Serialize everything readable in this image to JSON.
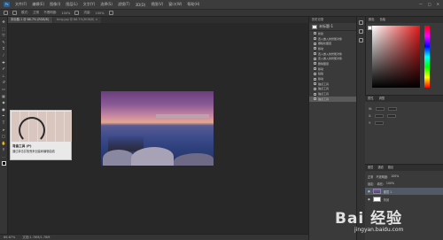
{
  "menubar": {
    "app_logo": "Ps",
    "items": [
      "文件(F)",
      "编辑(E)",
      "图像(I)",
      "图层(L)",
      "文字(Y)",
      "选择(S)",
      "滤镜(T)",
      "3D(D)",
      "视图(V)",
      "窗口(W)",
      "帮助(H)"
    ],
    "window_controls": [
      "—",
      "□",
      "✕"
    ]
  },
  "optionsbar": {
    "mode_label": "模式:",
    "mode_value": "正常",
    "opacity_label": "不透明度:",
    "opacity_value": "100%",
    "flow_label": "流量:",
    "flow_value": "100%"
  },
  "tabs": [
    {
      "label": "未标题-1 @ 66.7% (RGB/8)",
      "active": true
    },
    {
      "label": "timg.jpg @ 66.7%(RGB/8) ×",
      "active": false
    }
  ],
  "tooltip": {
    "title": "弯曲工具 (P)",
    "description": "通过单击并拖曳来创建和编辑曲线"
  },
  "statusbar": {
    "zoom": "66.67%",
    "doc_info": "文档:1.76M/1.76M"
  },
  "history": {
    "header": "历史记录",
    "snapshot": "未标题-1",
    "items": [
      {
        "label": "新建",
        "selected": false
      },
      {
        "label": "置入嵌入的智能对象",
        "selected": false
      },
      {
        "label": "栅格化图层",
        "selected": false
      },
      {
        "label": "移动",
        "selected": false
      },
      {
        "label": "置入嵌入的智能对象",
        "selected": false
      },
      {
        "label": "置入嵌入的智能对象",
        "selected": false
      },
      {
        "label": "删除图层",
        "selected": false
      },
      {
        "label": "移动",
        "selected": false
      },
      {
        "label": "粘贴",
        "selected": false
      },
      {
        "label": "移动",
        "selected": false
      },
      {
        "label": "锚点工具",
        "selected": false
      },
      {
        "label": "锚点工具",
        "selected": false
      },
      {
        "label": "锚点工具",
        "selected": false
      },
      {
        "label": "锚点工具",
        "selected": false
      }
    ]
  },
  "color_panel": {
    "tabs": [
      "颜色",
      "色板"
    ],
    "hue_color": "#e11b1b"
  },
  "properties": {
    "tabs": [
      "属性",
      "调整"
    ],
    "rows": [
      "W:",
      "X:",
      "Y:"
    ]
  },
  "layers": {
    "tabs": [
      "图层",
      "通道",
      "路径"
    ],
    "blend": "正常",
    "opacity_label": "不透明度:",
    "opacity_value": "100%",
    "lock_label": "锁定:",
    "fill_label": "填充:",
    "fill_value": "100%",
    "rows": [
      {
        "name": "图层 1",
        "selected": true
      },
      {
        "name": "背景",
        "selected": false
      }
    ]
  },
  "watermark": {
    "text": "Bai 经验",
    "url": "jingyan.baidu.com"
  }
}
